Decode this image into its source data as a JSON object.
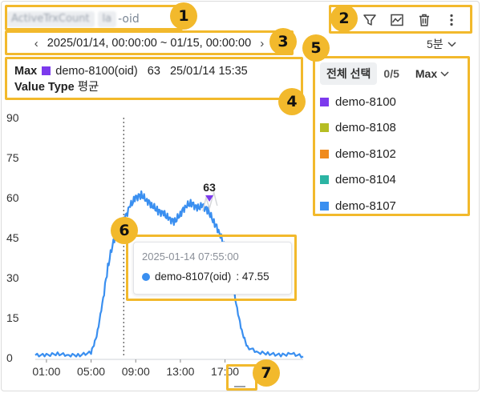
{
  "header": {
    "title_blurred_1": "ActiveTrxCount",
    "title_blurred_2": "la",
    "title_suffix": "-oid"
  },
  "toolbar": {
    "icons": [
      "filter-icon",
      "chart-type-icon",
      "trash-icon",
      "more-vertical-icon"
    ]
  },
  "time_range": {
    "prev": "‹",
    "next": "›",
    "label": "2025/01/14, 00:00:00 ~ 01/15, 00:00:00"
  },
  "interval": {
    "label": "5분",
    "chevron": "⌄"
  },
  "summary": {
    "agg_label": "Max",
    "instance": "demo-8100(oid)",
    "value": "63",
    "time": "25/01/14 15:35",
    "value_type_label": "Value Type",
    "value_type": "평균",
    "color": "#7c3aed"
  },
  "legend": {
    "select_all": "전체 선택",
    "count": "0/5",
    "agg": "Max",
    "items": [
      {
        "label": "demo-8100",
        "color": "#7c3aed"
      },
      {
        "label": "demo-8108",
        "color": "#b5bd23"
      },
      {
        "label": "demo-8102",
        "color": "#f08a1c"
      },
      {
        "label": "demo-8104",
        "color": "#2bb4a3"
      },
      {
        "label": "demo-8107",
        "color": "#3a8ff0"
      }
    ]
  },
  "tooltip": {
    "time": "2025-01-14 07:55:00",
    "series": "demo-8107(oid)",
    "value": ": 47.55",
    "color": "#3a8ff0"
  },
  "callouts": [
    "1",
    "2",
    "3",
    "4",
    "5",
    "6",
    "7"
  ],
  "chart_data": {
    "type": "line",
    "ylim": [
      0,
      90
    ],
    "yticks": [
      "0",
      "15",
      "30",
      "45",
      "60",
      "75",
      "90"
    ],
    "xticks": [
      "01:00",
      "05:00",
      "09:00",
      "13:00",
      "17:00"
    ],
    "peak_label": "63",
    "series": [
      {
        "name": "demo-8107",
        "color": "#3a8ff0",
        "x_hours": [
          0,
          1,
          2,
          3,
          4,
          5,
          5.5,
          6,
          6.5,
          7,
          7.5,
          8,
          8.5,
          9,
          9.5,
          10,
          10.5,
          11,
          11.5,
          12,
          12.5,
          13,
          13.5,
          14,
          14.5,
          15,
          15.5,
          16,
          16.5,
          17,
          17.5,
          18,
          18.5,
          19,
          20,
          21,
          22,
          23,
          24
        ],
        "values": [
          1,
          1,
          1.5,
          1,
          1,
          2,
          8,
          20,
          34,
          44,
          47.5,
          52,
          57,
          60,
          61,
          59,
          57,
          55,
          54,
          52,
          51,
          54,
          57,
          58,
          56,
          57,
          55,
          51,
          47,
          41,
          32,
          20,
          10,
          4,
          2,
          1.5,
          1,
          1.5,
          0.5
        ]
      }
    ],
    "crosshair_hour": 7.92
  }
}
